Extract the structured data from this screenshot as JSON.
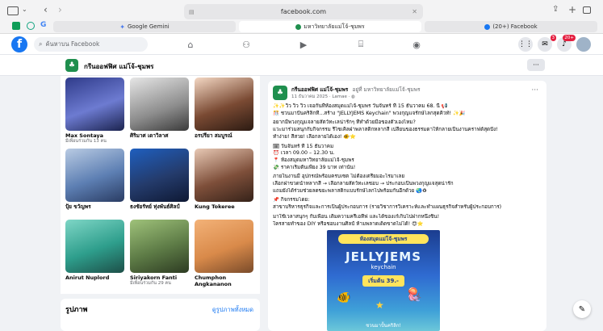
{
  "browser": {
    "address": "facebook.com",
    "tabs": [
      {
        "label": "Google Gemini"
      },
      {
        "label": "มหาวิทยาลัยแม่โจ้-ชุมพร"
      },
      {
        "label": "(20+) Facebook"
      }
    ]
  },
  "fb": {
    "search_placeholder": "ค้นหาบน Facebook",
    "notif_badge": "3",
    "alerts_badge": "20+"
  },
  "group": {
    "name": "กรีนออฟฟิศ แม่โจ้-ชุมพร"
  },
  "people": [
    {
      "name": "Max Sontaya",
      "sub": "มีเพื่อนร่วมกัน 13 คน"
    },
    {
      "name": "ศิริมาศ เดาวิลาศ",
      "sub": ""
    },
    {
      "name": "อรปรียา สมบูรณ์",
      "sub": ""
    },
    {
      "name": "ปุ้ย ขวัญพร",
      "sub": ""
    },
    {
      "name": "ธงชัยรัทย์ ทุ่งพันธ์ศิลป์",
      "sub": ""
    },
    {
      "name": "Kung Tokeree",
      "sub": ""
    },
    {
      "name": "Anirut Nuplord",
      "sub": ""
    },
    {
      "name": "Siriyakorn Fanti",
      "sub": "มีเพื่อนร่วมกัน 29 คน"
    },
    {
      "name": "Chumphon Angkananon",
      "sub": ""
    }
  ],
  "photos": {
    "title": "รูปภาพ",
    "link": "ดูรูปภาพทั้งหมด"
  },
  "post": {
    "author": "กรีนออฟฟิศ แม่โจ้-ชุมพร",
    "location": "อยู่ที่ มหาวิทยาลัยแม่โจ้-ชุมพร",
    "time": "11 ธันวาคม 2025 · Lamae ·",
    "lines": [
      "✨✨วิ้ว วิ้ว วิ้ว เจอกันที่ห้องสมุดแม่โจ้-ชุมพร วันจันทร์ ที่ 15 ธันวาคม 68. นี้ 📢",
      "🎊 ชวนมาปั้นคริลิกที่...สร้าง \"JELLYJEMS Keychain\" พวงกุญแจรักษ์โลกสุดคิวท์! ✨🎉",
      "อยากมีพวงกุญแจลายสัตว์ทะเลน่ารักๆ ที่ทำด้วยมือของตัวเองไหม?",
      "แวะมาร่วมสนุกกับกิจกรรม รีไซเคิลฝาพลาสติกหลากสี เปลี่ยนของธรรมดาให้กลายเป็นงานคราฟต์สุดปัง!",
      "ทำง่าย! สีสวย! เลือกลายได้เอง! 🐠⭐",
      "🗓 วันจันทร์ ที่ 15 ธันวาคม",
      "⏰ เวลา 09.00 – 12.30 น.",
      "📍 ห้องสมุดมหาวิทยาลัยแม่โจ้-ชุมพร",
      "💸 ราคาเริ่มต้นเพียง 39 บาท เท่านั้น!",
      "ภายในงานมี อุปกรณ์พร้อมครบเซต ไม่ต้องเตรียมอะไรมาเลย",
      "เลือกฝาขวดน้ำหลากสี → เลือกลายสัตว์ทะเลชอบ → ประกอบเป็นพวงกุญแจสุดน่ารัก",
      "แถมยังได้ร่วมช่วยลดขยะพลาสติกแบบรักษ์โลกไปพร้อมกันอีกด้วย 🌏♻",
      "📌 กิจกรรมโดย:",
      "สาขาบริหารธุรกิจและการเป็นผู้ประกอบการ (รายวิชาการวิเคราะห์และทำแผนธุรกิจสำหรับผู้ประกอบการ)",
      "มาใช้เวลาสนุกๆ กับเพื่อน เติมความครีเอทีฟ และได้ของเก๋เก็บไปฝากหนึ่งชิ้น!",
      "ใครสายทำของ DIY หรือชอบงานศิลป์ ห้ามพลาดเด็ดขาดไม่ได้! 😍⭐"
    ],
    "poster": {
      "title": "ห้องสมุดแม่โจ้-ชุมพร",
      "brand": "JELLYJEMS",
      "sub": "keychain",
      "price": "เริ่มต้น 39.-",
      "footer": "ชวนมาปั้นคริลิก!"
    }
  },
  "colors": {
    "fb_blue": "#1877f2",
    "group_green": "#1f8f4e"
  }
}
